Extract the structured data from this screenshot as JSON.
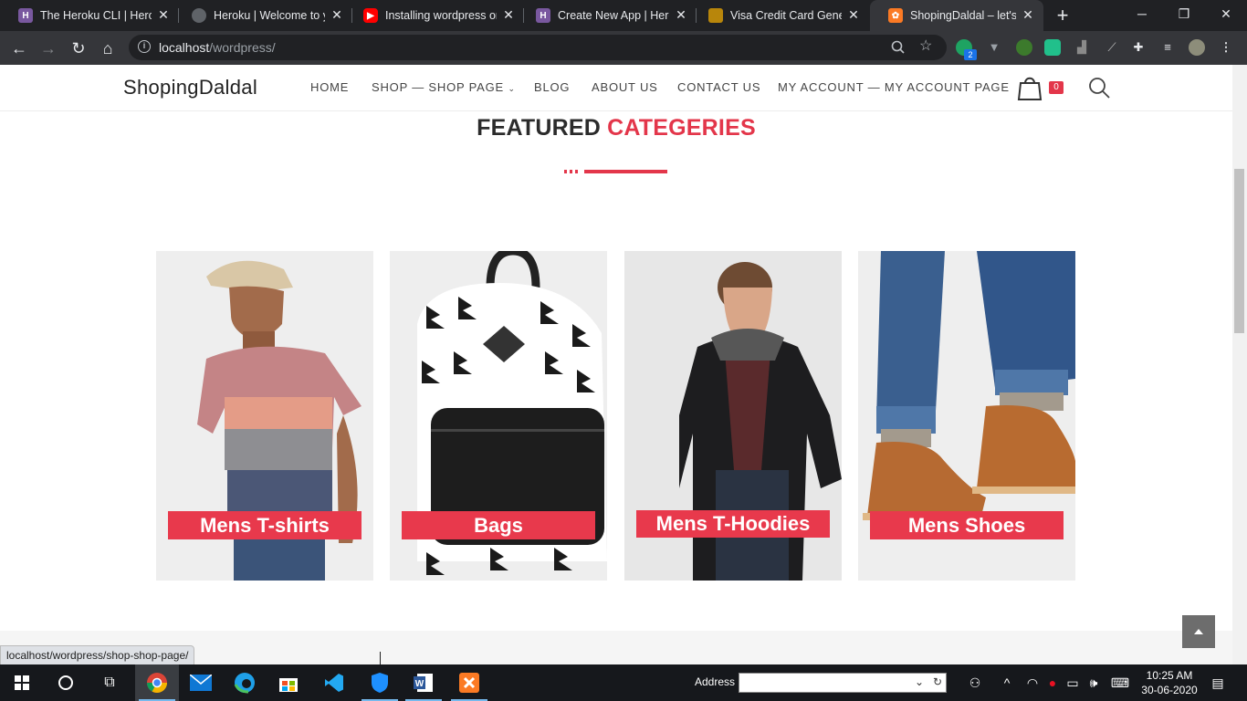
{
  "browser": {
    "tabs": [
      {
        "title": "The Heroku CLI | Heroku",
        "favicon": "heroku-icon",
        "active": false
      },
      {
        "title": "Heroku | Welcome to your new app",
        "favicon": "globe-icon",
        "active": false
      },
      {
        "title": "Installing wordpress on",
        "favicon": "youtube-icon",
        "active": false
      },
      {
        "title": "Create New App | Heroku",
        "favicon": "heroku-icon",
        "active": false
      },
      {
        "title": "Visa Credit Card Generator",
        "favicon": "card-icon",
        "active": false
      },
      {
        "title": "ShopingDaldal – let's go",
        "favicon": "xampp-icon",
        "active": true
      }
    ],
    "new_tab": "+",
    "url_host": "localhost",
    "url_path": "/wordpress/",
    "ext_badge": "2",
    "status_url": "localhost/wordpress/shop-shop-page/"
  },
  "site": {
    "logo": "ShopingDaldal",
    "menu": [
      {
        "label": "HOME",
        "has_dropdown": false
      },
      {
        "label": "SHOP — SHOP PAGE",
        "has_dropdown": true
      },
      {
        "label": "BLOG",
        "has_dropdown": false
      },
      {
        "label": "ABOUT US",
        "has_dropdown": false
      },
      {
        "label": "CONTACT US",
        "has_dropdown": false
      },
      {
        "label": "MY ACCOUNT — MY ACCOUNT PAGE",
        "has_dropdown": false
      }
    ],
    "cart_count": "0",
    "accent_color": "#e3364a"
  },
  "featured": {
    "title_plain": "FEATURED ",
    "title_accent": "CATEGERIES",
    "categories": [
      {
        "label": "Mens T-shirts",
        "image": "man-in-striped-polo-and-cap"
      },
      {
        "label": "Bags",
        "image": "black-and-white-patterned-backpack"
      },
      {
        "label": "Mens T-Hoodies",
        "image": "man-in-black-hoodie"
      },
      {
        "label": "Mens Shoes",
        "image": "tan-suede-chukka-boots-with-rolled-jeans"
      }
    ]
  },
  "taskbar": {
    "address_label": "Address",
    "time": "10:25 AM",
    "date": "30-06-2020"
  }
}
